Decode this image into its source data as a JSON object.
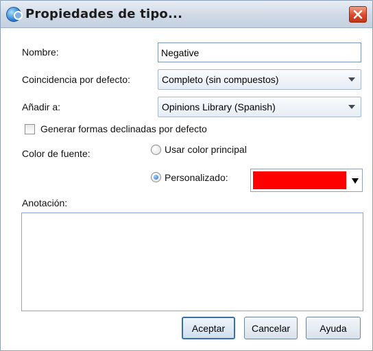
{
  "window": {
    "title": "Propiedades de tipo..."
  },
  "form": {
    "nombre_label": "Nombre:",
    "nombre_value": "Negative",
    "coincidencia_label": "Coincidencia por defecto:",
    "coincidencia_value": "Completo (sin compuestos)",
    "anadir_label": "Añadir a:",
    "anadir_value": "Opinions Library (Spanish)",
    "generar_label": "Generar formas declinadas por defecto",
    "generar_checked": false,
    "color_label": "Color de fuente:",
    "usar_color_label": "Usar color principal",
    "personalizado_label": "Personalizado:",
    "selected_color_mode": "personalizado",
    "custom_color": "#ff0000",
    "anotacion_label": "Anotación:",
    "anotacion_value": ""
  },
  "buttons": {
    "aceptar": "Aceptar",
    "cancelar": "Cancelar",
    "ayuda": "Ayuda"
  },
  "icons": {
    "title_icon": "text-analytics-icon",
    "close_icon": "close-icon",
    "dropdown_icon": "chevron-down-icon"
  },
  "colors": {
    "titlebar_top": "#e9eef5",
    "close_button": "#d9492a",
    "default_button_border": "#3a6ea5"
  }
}
